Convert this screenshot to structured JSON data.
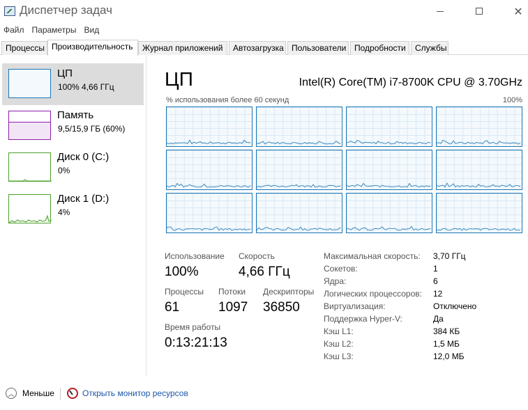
{
  "window": {
    "title": "Диспетчер задач"
  },
  "menu": [
    "Файл",
    "Параметры",
    "Вид"
  ],
  "tabs": [
    "Процессы",
    "Производительность",
    "Журнал приложений",
    "Автозагрузка",
    "Пользователи",
    "Подробности",
    "Службы"
  ],
  "active_tab": "Производительность",
  "sidebar": [
    {
      "name": "ЦП",
      "value": "100% 4,66 ГГц"
    },
    {
      "name": "Память",
      "value": "9,5/15,9 ГБ (60%)"
    },
    {
      "name": "Диск 0 (C:)",
      "value": "0%"
    },
    {
      "name": "Диск 1 (D:)",
      "value": "4%"
    }
  ],
  "main": {
    "title": "ЦП",
    "model": "Intel(R) Core(TM) i7-8700K CPU @ 3.70GHz",
    "graph_caption": "% использования более 60 секунд",
    "graph_max": "100%"
  },
  "stats": {
    "usage_label": "Использование",
    "usage_value": "100%",
    "speed_label": "Скорость",
    "speed_value": "4,66 ГГц",
    "processes_label": "Процессы",
    "processes_value": "61",
    "threads_label": "Потоки",
    "threads_value": "1097",
    "handles_label": "Дескрипторы",
    "handles_value": "36850",
    "uptime_label": "Время работы",
    "uptime_value": "0:13:21:13"
  },
  "details": [
    {
      "label": "Максимальная скорость:",
      "value": "3,70 ГГц"
    },
    {
      "label": "Сокетов:",
      "value": "1"
    },
    {
      "label": "Ядра:",
      "value": "6"
    },
    {
      "label": "Логических процессоров:",
      "value": "12"
    },
    {
      "label": "Виртуализация:",
      "value": "Отключено"
    },
    {
      "label": "Поддержка Hyper-V:",
      "value": "Да"
    },
    {
      "label": "Кэш L1:",
      "value": "384 КБ"
    },
    {
      "label": "Кэш L2:",
      "value": "1,5 МБ"
    },
    {
      "label": "Кэш L3:",
      "value": "12,0 МБ"
    }
  ],
  "footer": {
    "less_label": "Меньше",
    "resource_monitor_label": "Открыть монитор ресурсов"
  },
  "colors": {
    "cpu": "#1976b5",
    "memory": "#8b1fa9",
    "disk": "#4aa12b",
    "link": "#1a56a7"
  },
  "icons": [
    "task-manager-icon",
    "minimize-icon",
    "maximize-icon",
    "close-icon",
    "chevron-up-icon",
    "resource-monitor-icon"
  ]
}
